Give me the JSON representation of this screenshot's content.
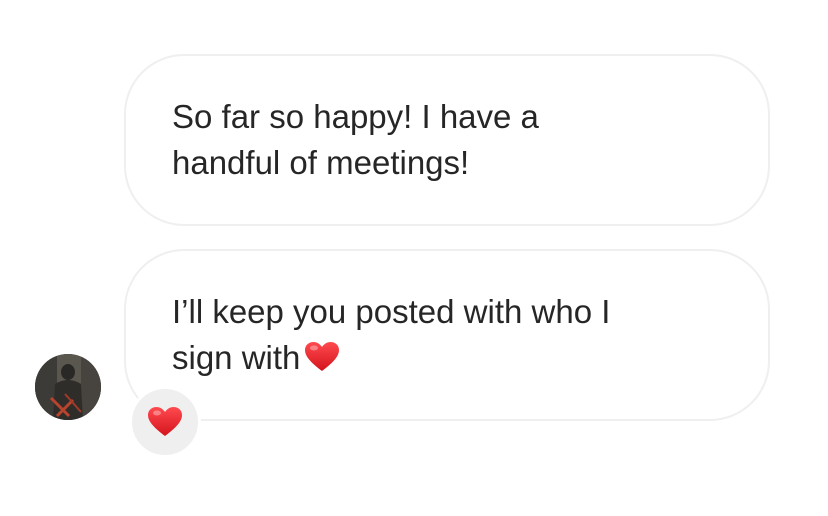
{
  "messages": [
    {
      "line1": "So far so happy! I have a",
      "line2": "handful of meetings!"
    },
    {
      "line1": "I’ll keep you posted with who I",
      "line2": "sign with"
    }
  ],
  "icons": {
    "inline_emoji": "red-heart-icon",
    "reaction_emoji": "red-heart-icon",
    "avatar": "avatar-photo"
  },
  "colors": {
    "text": "#262626",
    "bubble_border": "#efefef",
    "reaction_bg": "#efefef",
    "heart": "#e0202b"
  }
}
